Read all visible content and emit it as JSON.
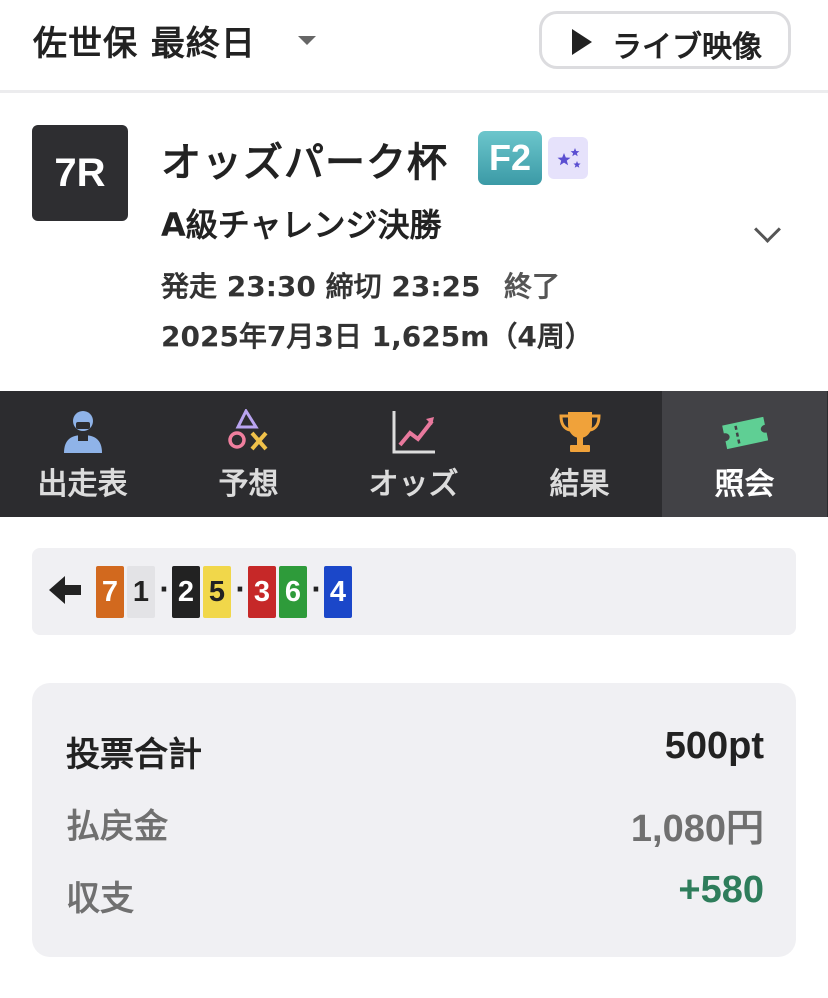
{
  "header": {
    "venue": "佐世保 最終日",
    "live_label": "ライブ映像"
  },
  "race": {
    "number": "7R",
    "title": "オッズパーク杯",
    "grade": "F2",
    "subtitle": "A級チャレンジ決勝",
    "start_close": "発走 23:30 締切 23:25",
    "status": "終了",
    "date_distance": "2025年7月3日 1,625m（4周）"
  },
  "tabs": [
    {
      "label": "出走表",
      "icon": "rider-icon"
    },
    {
      "label": "予想",
      "icon": "prediction-icon"
    },
    {
      "label": "オッズ",
      "icon": "odds-chart-icon"
    },
    {
      "label": "結果",
      "icon": "trophy-icon"
    },
    {
      "label": "照会",
      "icon": "ticket-icon",
      "active": true
    }
  ],
  "lineup": {
    "groups": [
      [
        {
          "num": "7",
          "bg": "#d2691e",
          "fg": "#ffffff"
        },
        {
          "num": "1",
          "bg": "#e3e3e6",
          "fg": "#222222"
        }
      ],
      [
        {
          "num": "2",
          "bg": "#222222",
          "fg": "#ffffff"
        },
        {
          "num": "5",
          "bg": "#f1d74a",
          "fg": "#222222"
        }
      ],
      [
        {
          "num": "3",
          "bg": "#c62828",
          "fg": "#ffffff"
        },
        {
          "num": "6",
          "bg": "#2e9b3a",
          "fg": "#ffffff"
        }
      ],
      [
        {
          "num": "4",
          "bg": "#1b47c9",
          "fg": "#ffffff"
        }
      ]
    ]
  },
  "summary": {
    "total_label": "投票合計",
    "total_value": "500pt",
    "payout_label": "払戻金",
    "payout_value": "1,080円",
    "balance_label": "収支",
    "balance_value": "+580"
  },
  "colors": {
    "balance_positive": "#2e7d5b",
    "muted_text": "#707070"
  }
}
